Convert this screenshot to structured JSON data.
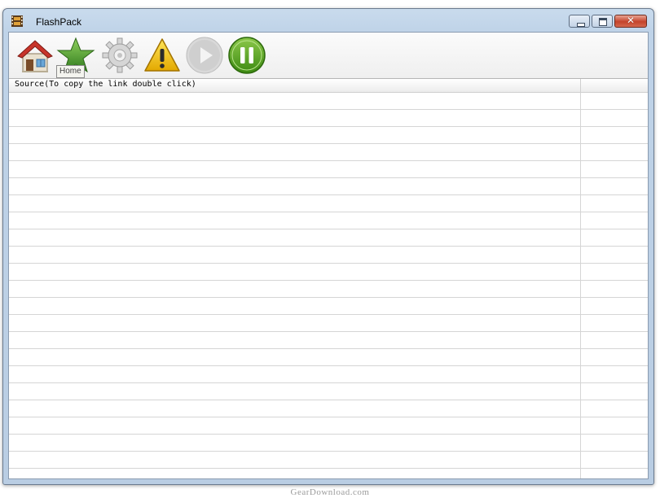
{
  "window": {
    "title": "FlashPack",
    "controls": {
      "minimize": "minimize",
      "maximize": "maximize",
      "close_glyph": "✕"
    }
  },
  "toolbar": {
    "buttons": [
      {
        "id": "home",
        "icon": "home-icon"
      },
      {
        "id": "favorites",
        "icon": "star-icon"
      },
      {
        "id": "settings",
        "icon": "gear-icon"
      },
      {
        "id": "warning",
        "icon": "warning-icon"
      },
      {
        "id": "play",
        "icon": "play-icon",
        "state": "disabled"
      },
      {
        "id": "pause",
        "icon": "pause-icon"
      }
    ],
    "tooltip": "Home"
  },
  "list": {
    "columns": [
      {
        "label": "Source(To copy the link double click)"
      },
      {
        "label": ""
      }
    ],
    "row_count": 23
  },
  "watermark": "GearDownload.com",
  "colors": {
    "titlebar": "#bfd3e8",
    "pause_green": "#4e9a18",
    "star_green": "#4a9a2c",
    "warning_yellow": "#f0c000",
    "home_roof": "#c8342a",
    "close_red": "#c4432b"
  }
}
